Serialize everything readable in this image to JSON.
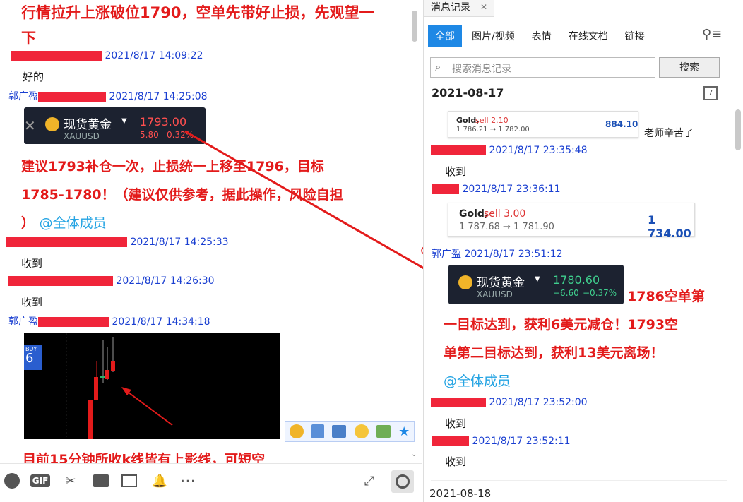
{
  "left": {
    "top_message": {
      "line1": "行情拉升上涨破位1790，空单先带好止损，先观望一",
      "line2": "下"
    },
    "msgs": [
      {
        "time": "2021/8/17 14:09:22",
        "text": "好的"
      },
      {
        "sender": "郭广盈",
        "time": "2021/8/17 14:25:08"
      },
      {
        "time": "2021/8/17 14:25:33",
        "text": "收到"
      },
      {
        "time": "2021/8/17 14:26:30",
        "text": "收到"
      },
      {
        "sender": "郭广盈",
        "time": "2021/8/17 14:34:18"
      }
    ],
    "gold_card": {
      "name": "现货黄金",
      "code": "XAUUSD",
      "price": "1793.00",
      "change": "5.80",
      "pct": "0.32%"
    },
    "advice": {
      "line1": "建议1793补仓一次，止损统一上移至1796，目标",
      "line2": "1785-1780！（建议仅供参考，据此操作，风险自担",
      "line3": "）",
      "mention": "@全体成员"
    },
    "chart_label": {
      "buy": "BUY",
      "num": "6"
    },
    "bottom_text": "目前15分钟所收k线皆有上影线，可短空"
  },
  "toolbar": {
    "gif": "GIF"
  },
  "right": {
    "title": "消息记录",
    "tabs": [
      "全部",
      "图片/视频",
      "表情",
      "在线文档",
      "链接"
    ],
    "search_placeholder": "搜索消息记录",
    "search_button": "搜索",
    "date1": "2021-08-17",
    "calendar_num": "7",
    "quote1": {
      "name": "Gold,",
      "action": "sell 2.10",
      "range": "1 786.21 → 1 782.00",
      "value": "884.10",
      "note": "老师辛苦了"
    },
    "msg_a": {
      "time": "2021/8/17 23:35:48",
      "text": "收到"
    },
    "msg_b": {
      "time": "2021/8/17 23:36:11"
    },
    "quote2": {
      "name": "Gold,",
      "action": "sell 3.00",
      "range": "1 787.68 → 1 781.90",
      "value": "1 734.00"
    },
    "msg_c": {
      "sender": "郭广盈",
      "time": "2021/8/17 23:51:12"
    },
    "gold_card": {
      "name": "现货黄金",
      "code": "XAUUSD",
      "price": "1780.60",
      "change": "−6.60",
      "pct": "−0.37%"
    },
    "result": {
      "line1": "1786空单第",
      "line2": "一目标达到，获利6美元减仓！1793空",
      "line3": "单第二目标达到，获利13美元离场！",
      "mention": "@全体成员"
    },
    "msg_d": {
      "time": "2021/8/17 23:52:00",
      "text": "收到"
    },
    "msg_e": {
      "time": "2021/8/17 23:52:11",
      "text": "收到"
    },
    "date2": "2021-08-18"
  }
}
